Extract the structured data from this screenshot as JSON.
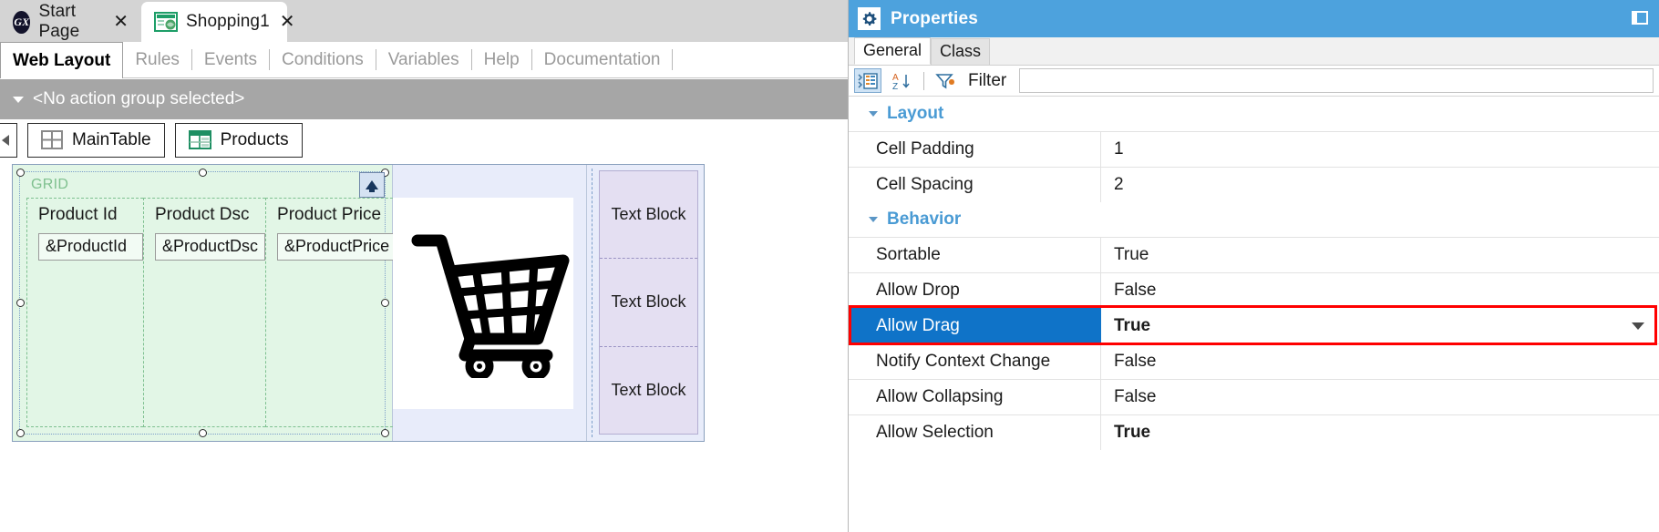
{
  "document_tabs": [
    {
      "label": "Start Page",
      "icon": "gx-logo-icon",
      "active": false,
      "close": "✕"
    },
    {
      "label": "Shopping1",
      "icon": "web-panel-icon",
      "active": true,
      "close": "✕"
    }
  ],
  "object_tabs": [
    {
      "label": "Web Layout",
      "active": true
    },
    {
      "label": "Rules",
      "active": false
    },
    {
      "label": "Events",
      "active": false
    },
    {
      "label": "Conditions",
      "active": false
    },
    {
      "label": "Variables",
      "active": false
    },
    {
      "label": "Help",
      "active": false
    },
    {
      "label": "Documentation",
      "active": false
    }
  ],
  "action_bar": {
    "label": "<No action group selected>",
    "caret": "chevron-down-icon"
  },
  "breadcrumb": {
    "scroll_left_icon": "chevron-left-icon",
    "items": [
      {
        "label": "MainTable",
        "icon": "table-grid-icon"
      },
      {
        "label": "Products",
        "icon": "grid-control-icon"
      }
    ]
  },
  "designer": {
    "grid": {
      "label": "GRID",
      "move_up_icon": "arrow-up-icon",
      "columns": [
        {
          "header": "Product Id",
          "variable": "&ProductId"
        },
        {
          "header": "Product Dsc",
          "variable": "&ProductDsc"
        },
        {
          "header": "Product Price",
          "variable": "&ProductPrice"
        }
      ]
    },
    "image_cell": {
      "icon": "shopping-cart-icon"
    },
    "text_blocks": [
      {
        "label": "Text Block"
      },
      {
        "label": "Text Block"
      },
      {
        "label": "Text Block"
      }
    ]
  },
  "properties": {
    "title": "Properties",
    "gear_icon": "gear-icon",
    "pin_icon": "unpin-icon",
    "tabs": [
      {
        "label": "General",
        "active": true
      },
      {
        "label": "Class",
        "active": false
      }
    ],
    "toolbar": {
      "categorized_icon": "categorized-list-icon",
      "alphabetical_icon": "sort-az-icon",
      "filter_icon": "filter-funnel-icon",
      "filter_label": "Filter",
      "filter_value": "",
      "filter_placeholder": ""
    },
    "sections": [
      {
        "name": "Layout",
        "caret": "chevron-down-icon",
        "rows": [
          {
            "name": "Cell Padding",
            "value": "1",
            "bold": false,
            "selected": false
          },
          {
            "name": "Cell Spacing",
            "value": "2",
            "bold": false,
            "selected": false
          }
        ]
      },
      {
        "name": "Behavior",
        "caret": "chevron-down-icon",
        "rows": [
          {
            "name": "Sortable",
            "value": "True",
            "bold": false,
            "selected": false
          },
          {
            "name": "Allow Drop",
            "value": "False",
            "bold": false,
            "selected": false
          },
          {
            "name": "Allow Drag",
            "value": "True",
            "bold": true,
            "selected": true,
            "highlighted": true,
            "dropdown": true
          },
          {
            "name": "Notify Context Change",
            "value": "False",
            "bold": false,
            "selected": false
          },
          {
            "name": "Allow Collapsing",
            "value": "False",
            "bold": false,
            "selected": false
          },
          {
            "name": "Allow Selection",
            "value": "True",
            "bold": true,
            "selected": false
          }
        ]
      }
    ]
  },
  "colors": {
    "accent_blue": "#4da2dd",
    "selection_blue": "#0f73c8",
    "highlight_red": "#ff0000",
    "grid_green": "#e2f6e6",
    "textblock_lavender": "#e4dff2",
    "section_header": "#4a9bd4"
  }
}
